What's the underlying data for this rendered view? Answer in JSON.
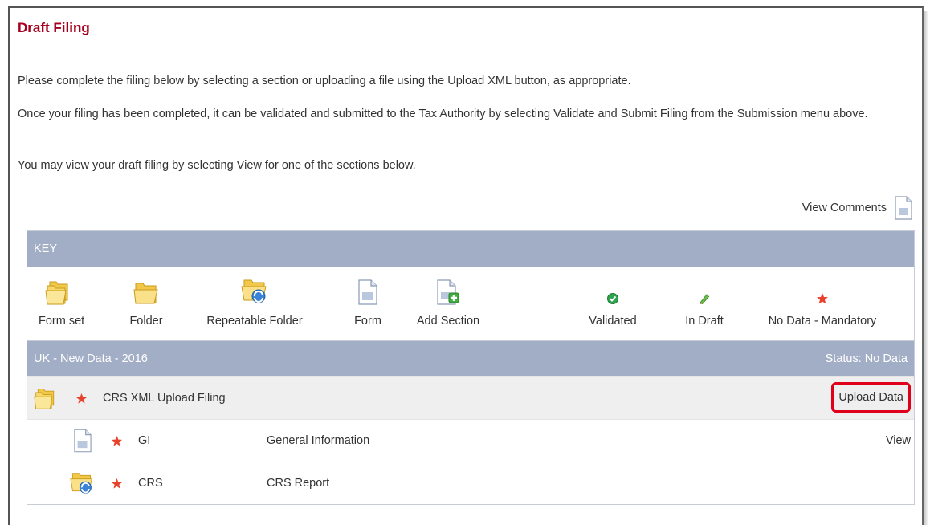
{
  "page": {
    "title": "Draft Filing",
    "paragraph_1": "Please complete the filing below by selecting a section or uploading a file using the Upload XML button, as appropriate.",
    "paragraph_2": "Once your filing has been completed, it can be validated and submitted to the Tax Authority by selecting Validate and Submit Filing from the Submission menu above.",
    "paragraph_3": "You may view your draft filing by selecting View for one of the sections below.",
    "view_comments": "View Comments"
  },
  "key": {
    "header": "KEY",
    "items": [
      {
        "icon": "form-set-icon",
        "label": "Form set"
      },
      {
        "icon": "folder-icon",
        "label": "Folder"
      },
      {
        "icon": "repeatable-folder-icon",
        "label": "Repeatable Folder"
      },
      {
        "icon": "form-icon",
        "label": "Form"
      },
      {
        "icon": "add-section-icon",
        "label": "Add Section"
      },
      {
        "icon": "validated-icon",
        "label": "Validated"
      },
      {
        "icon": "in-draft-icon",
        "label": "In Draft"
      },
      {
        "icon": "no-data-mandatory-icon",
        "label": "No Data - Mandatory"
      }
    ]
  },
  "filing": {
    "group_title": "UK - New Data - 2016",
    "status": "Status: No Data",
    "main_row": {
      "label": "CRS XML Upload Filing",
      "action": "Upload Data"
    },
    "sections": [
      {
        "code": "GI",
        "name": "General Information",
        "action": "View",
        "icon": "form-icon"
      },
      {
        "code": "CRS",
        "name": "CRS Report",
        "action": "",
        "icon": "repeatable-folder-icon"
      }
    ]
  },
  "colors": {
    "title": "#a4001d",
    "bar": "#a2aec6",
    "highlight": "#e0001b",
    "star": "#e8412c",
    "validated": "#2ea44f"
  }
}
